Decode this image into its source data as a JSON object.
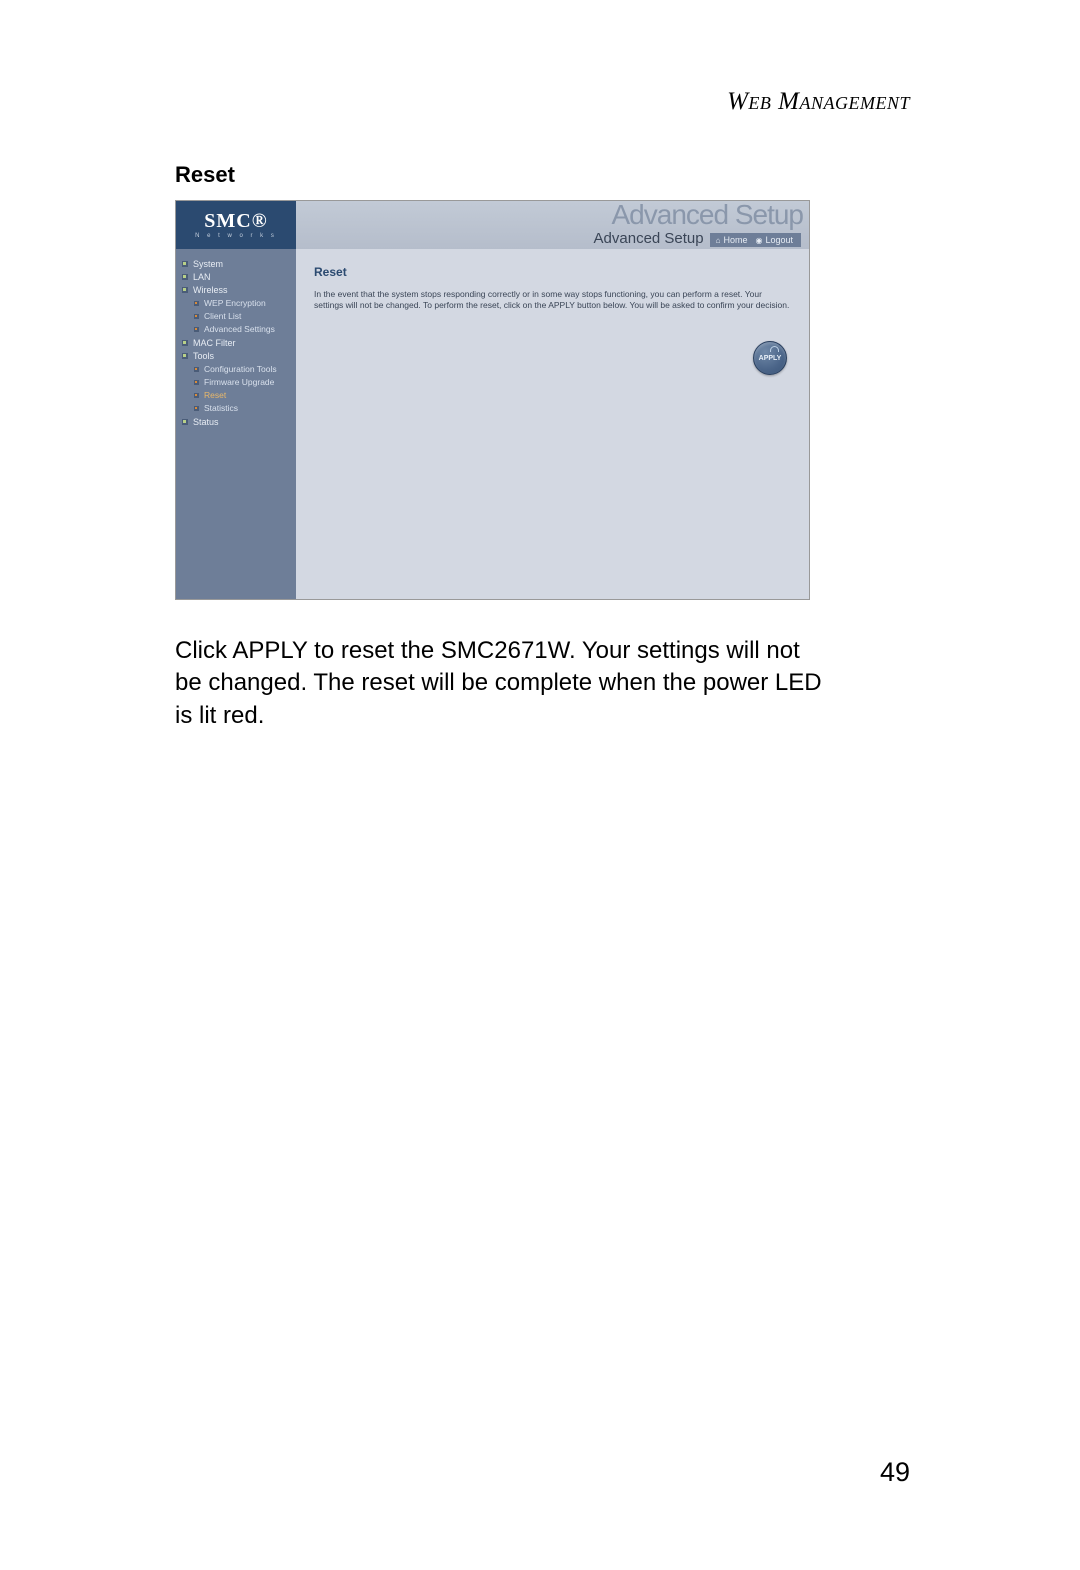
{
  "page": {
    "header": "Web Management",
    "section_title": "Reset",
    "body_text": "Click APPLY to reset the SMC2671W. Your settings will not be changed. The reset will be complete when the power LED is lit red.",
    "number": "49"
  },
  "screenshot": {
    "logo": {
      "main": "SMC®",
      "sub": "N e t w o r k s"
    },
    "header": {
      "bg_title": "Advanced Setup",
      "setup_label": "Advanced Setup",
      "home": "Home",
      "logout": "Logout"
    },
    "nav": {
      "system": "System",
      "lan": "LAN",
      "wireless": "Wireless",
      "wireless_sub": {
        "wep": "WEP Encryption",
        "client_list": "Client List",
        "advanced": "Advanced Settings"
      },
      "mac_filter": "MAC Filter",
      "tools": "Tools",
      "tools_sub": {
        "config": "Configuration Tools",
        "firmware": "Firmware Upgrade",
        "reset": "Reset",
        "statistics": "Statistics"
      },
      "status": "Status"
    },
    "content": {
      "title": "Reset",
      "text": "In the event that the system stops responding correctly or in some way stops functioning, you can perform a reset. Your settings will not be changed. To perform the reset, click on the APPLY button below. You will be asked to confirm your decision.",
      "apply": "APPLY"
    }
  }
}
